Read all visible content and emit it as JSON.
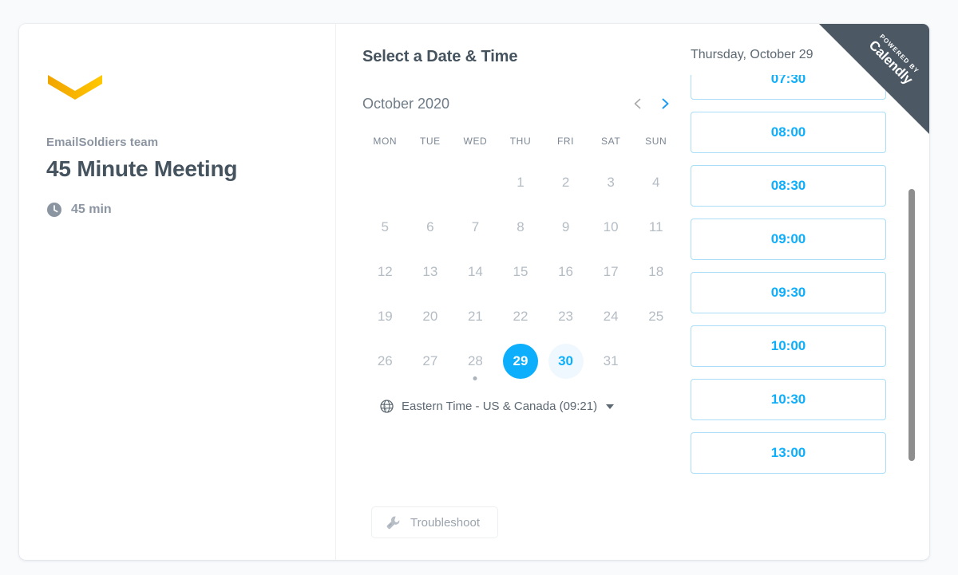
{
  "theme": {
    "page_background": "#f8fafc",
    "card_background": "#ffffff",
    "accent_blue": "#0daefc",
    "accent_blue_soft": "#eff8fe",
    "text_dark": "#45535f",
    "text_muted": "#8b95a1",
    "logo_orange": "#f5a623",
    "logo_yellow": "#fdc500",
    "ribbon_dark": "#4c5965"
  },
  "details": {
    "logo_icon": "chevron-down-logo",
    "organizer": "EmailSoldiers team",
    "event_title": "45 Minute Meeting",
    "duration_icon": "clock-icon",
    "duration": "45 min"
  },
  "calendar": {
    "section_title": "Select a Date & Time",
    "month_label": "October 2020",
    "prev_icon": "chevron-left-icon",
    "prev_enabled": false,
    "next_icon": "chevron-right-icon",
    "next_enabled": true,
    "weekdays": [
      "MON",
      "TUE",
      "WED",
      "THU",
      "FRI",
      "SAT",
      "SUN"
    ],
    "leading_blanks": 3,
    "days": [
      {
        "n": "1",
        "state": "disabled"
      },
      {
        "n": "2",
        "state": "disabled"
      },
      {
        "n": "3",
        "state": "disabled"
      },
      {
        "n": "4",
        "state": "disabled"
      },
      {
        "n": "5",
        "state": "disabled"
      },
      {
        "n": "6",
        "state": "disabled"
      },
      {
        "n": "7",
        "state": "disabled"
      },
      {
        "n": "8",
        "state": "disabled"
      },
      {
        "n": "9",
        "state": "disabled"
      },
      {
        "n": "10",
        "state": "disabled"
      },
      {
        "n": "11",
        "state": "disabled"
      },
      {
        "n": "12",
        "state": "disabled"
      },
      {
        "n": "13",
        "state": "disabled"
      },
      {
        "n": "14",
        "state": "disabled"
      },
      {
        "n": "15",
        "state": "disabled"
      },
      {
        "n": "16",
        "state": "disabled"
      },
      {
        "n": "17",
        "state": "disabled"
      },
      {
        "n": "18",
        "state": "disabled"
      },
      {
        "n": "19",
        "state": "disabled"
      },
      {
        "n": "20",
        "state": "disabled"
      },
      {
        "n": "21",
        "state": "disabled"
      },
      {
        "n": "22",
        "state": "disabled"
      },
      {
        "n": "23",
        "state": "disabled"
      },
      {
        "n": "24",
        "state": "disabled"
      },
      {
        "n": "25",
        "state": "disabled"
      },
      {
        "n": "26",
        "state": "disabled"
      },
      {
        "n": "27",
        "state": "disabled"
      },
      {
        "n": "28",
        "state": "disabled",
        "dot": true
      },
      {
        "n": "29",
        "state": "selected"
      },
      {
        "n": "30",
        "state": "available"
      },
      {
        "n": "31",
        "state": "disabled"
      }
    ],
    "timezone_icon": "globe-icon",
    "timezone_label": "Eastern Time - US & Canada (09:21)",
    "timezone_caret_icon": "caret-down-icon"
  },
  "footer": {
    "troubleshoot_icon": "wrench-icon",
    "troubleshoot_label": "Troubleshoot"
  },
  "slots": {
    "date_label": "Thursday, October 29",
    "times": [
      "07:30",
      "08:00",
      "08:30",
      "09:00",
      "09:30",
      "10:00",
      "10:30",
      "13:00"
    ],
    "scrolled": true
  },
  "ribbon": {
    "powered_by": "POWERED BY",
    "brand": "Calendly"
  }
}
